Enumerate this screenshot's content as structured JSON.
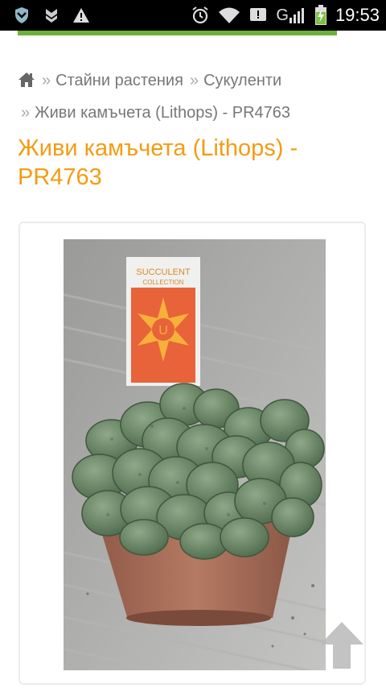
{
  "status_bar": {
    "time": "19:53",
    "signal_label": "G",
    "left_icons": [
      "shield-icon",
      "double-chevron-icon",
      "warning-icon"
    ],
    "right_icons": [
      "alarm-icon",
      "wifi-icon",
      "notification-icon",
      "cell-signal-icon",
      "battery-charging-icon"
    ]
  },
  "page_progress": 0.91,
  "colors": {
    "accent_orange": "#f39c12",
    "progress_green": "#6cb23a",
    "breadcrumb_text": "#777777"
  },
  "breadcrumb": {
    "home_icon": "home-icon",
    "separator": "»",
    "items": [
      "Стайни растения",
      "Сукуленти",
      "Живи камъчета (Lithops) - PR4763"
    ]
  },
  "product": {
    "title": "Живи камъчета (Lithops) - PR4763",
    "image": {
      "tag_line1": "SUCCULENT",
      "tag_line2": "COLLECTION",
      "emblem_letter": "U"
    }
  },
  "scroll_top_icon": "arrow-up-icon"
}
